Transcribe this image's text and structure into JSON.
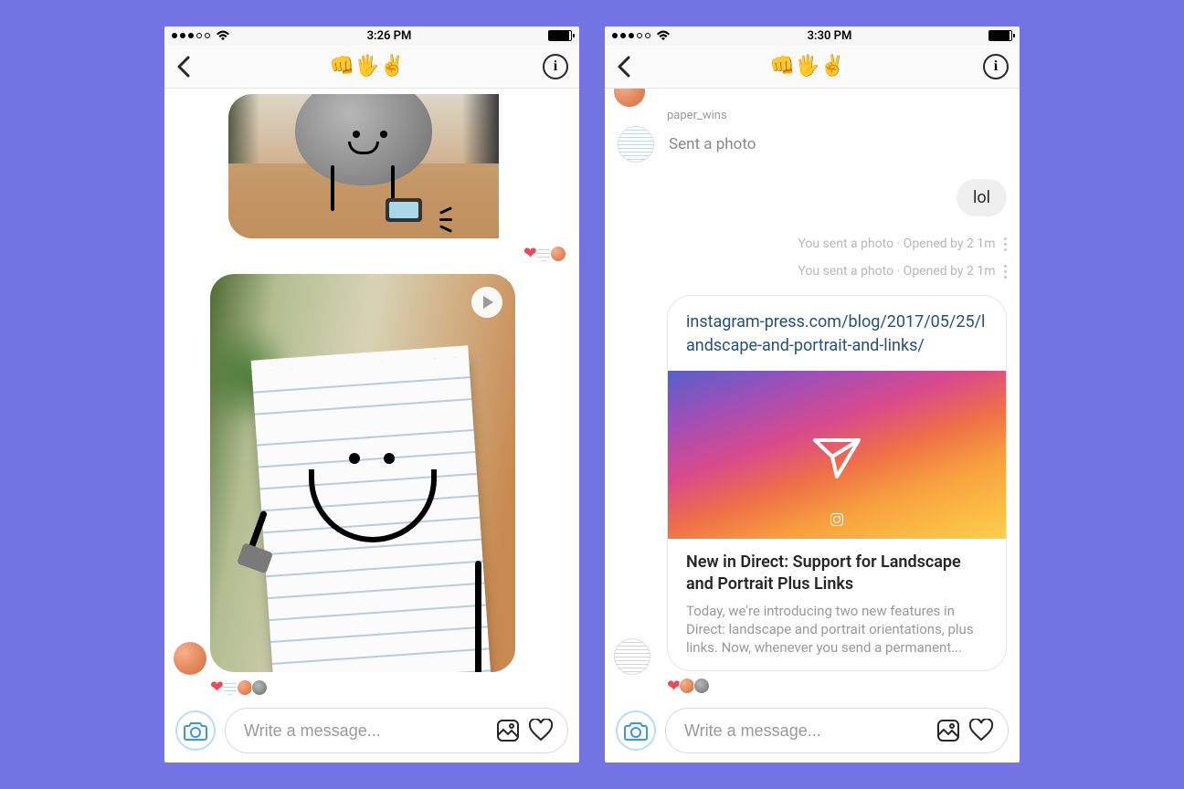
{
  "phone_left": {
    "time": "3:26 PM",
    "title": "👊🖐✌️",
    "input_placeholder": "Write a message..."
  },
  "phone_right": {
    "time": "3:30 PM",
    "title": "👊🖐✌️",
    "input_placeholder": "Write a message...",
    "sender_username": "paper_wins",
    "sent_photo_label": "Sent a photo",
    "reply_bubble": "lol",
    "status1_prefix": "You sent a photo · Opened by 2 ",
    "status1_time": "1m",
    "status2_prefix": "You sent a photo · Opened by 2 ",
    "status2_time": "1m",
    "link_url": "instagram-press.com/blog/2017/05/25/landscape-and-portrait-and-links/",
    "link_title": "New in Direct: Support for Landscape and Portrait Plus Links",
    "link_desc": "Today, we're introducing two new features in Direct: landscape and portrait orientations, plus links. Now, whenever you send a permanent..."
  }
}
